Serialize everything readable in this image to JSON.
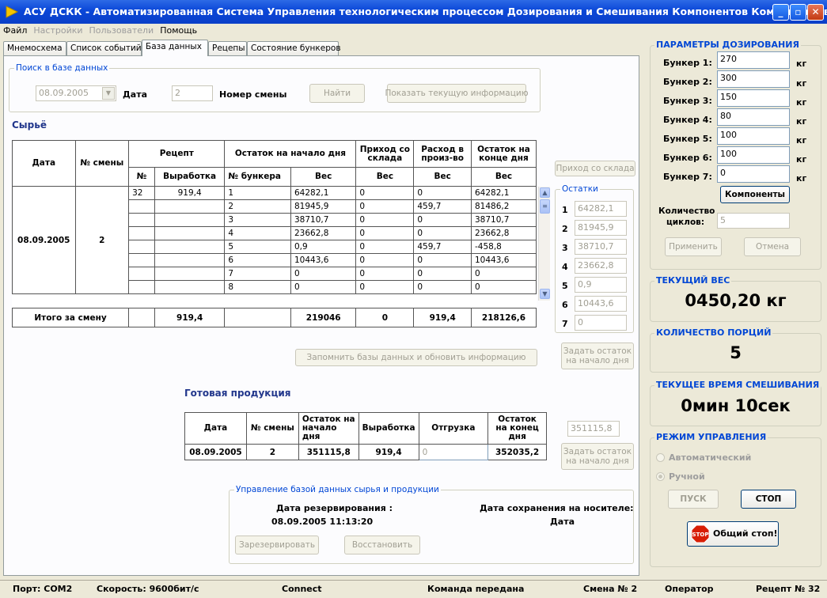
{
  "window": {
    "title": "АСУ ДСКК - Автоматизированная Система Управления технологическим процессом Дозирования и Смешивания Компонентов Комбикормов"
  },
  "menu": {
    "file": "Файл",
    "settings": "Настройки",
    "users": "Пользователи",
    "help": "Помощь"
  },
  "tabs": [
    "Мнемосхема",
    "Список событий",
    "База данных",
    "Рецепы",
    "Состояние бункеров"
  ],
  "search": {
    "title": "Поиск в базе данных",
    "date_value": "08.09.2005",
    "date_label": "Дата",
    "shift_value": "2",
    "shift_label": "Номер смены",
    "find_btn": "Найти",
    "show_btn": "Показать текущую информацию"
  },
  "raw": {
    "title": "Сырьё",
    "h_date": "Дата",
    "h_shift": "№ смены",
    "h_recipe": "Рецепт",
    "h_rec_no": "№",
    "h_rec_out": "Выработка",
    "h_start": "Остаток на начало дня",
    "h_bunker": "№ бункера",
    "h_weight": "Вес",
    "h_in": "Приход со склада",
    "h_use": "Расход в произ-во",
    "h_end": "Остаток на конце дня",
    "date": "08.09.2005",
    "shift": "2",
    "rec_no": "32",
    "rec_out": "919,4",
    "rows": [
      {
        "b": "1",
        "w": "64282,1",
        "in": "0",
        "use": "0",
        "end": "64282,1"
      },
      {
        "b": "2",
        "w": "81945,9",
        "in": "0",
        "use": "459,7",
        "end": "81486,2"
      },
      {
        "b": "3",
        "w": "38710,7",
        "in": "0",
        "use": "0",
        "end": "38710,7"
      },
      {
        "b": "4",
        "w": "23662,8",
        "in": "0",
        "use": "0",
        "end": "23662,8"
      },
      {
        "b": "5",
        "w": "0,9",
        "in": "0",
        "use": "459,7",
        "end": "-458,8"
      },
      {
        "b": "6",
        "w": "10443,6",
        "in": "0",
        "use": "0",
        "end": "10443,6"
      },
      {
        "b": "7",
        "w": "0",
        "in": "0",
        "use": "0",
        "end": "0"
      },
      {
        "b": "8",
        "w": "0",
        "in": "0",
        "use": "0",
        "end": "0"
      }
    ],
    "total_label": "Итого за смену",
    "total_out": "919,4",
    "total_w": "219046",
    "total_in": "0",
    "total_use": "919,4",
    "total_end": "218126,6",
    "income_btn": "Приход со склада",
    "remains_label": "Остатки",
    "remains": [
      {
        "n": "1",
        "v": "64282,1"
      },
      {
        "n": "2",
        "v": "81945,9"
      },
      {
        "n": "3",
        "v": "38710,7"
      },
      {
        "n": "4",
        "v": "23662,8"
      },
      {
        "n": "5",
        "v": "0,9"
      },
      {
        "n": "6",
        "v": "10443,6"
      },
      {
        "n": "7",
        "v": "0"
      }
    ],
    "save_btn": "Запомнить базы данных и обновить информацию",
    "set_btn": "Задать остаток на начало дня"
  },
  "product": {
    "title": "Готовая продукция",
    "h_date": "Дата",
    "h_shift": "№ смены",
    "h_start": "Остаток на начало дня",
    "h_out": "Выработка",
    "h_ship": "Отгрузка",
    "h_end": "Остаток на конец дня",
    "date": "08.09.2005",
    "shift": "2",
    "start": "351115,8",
    "out": "919,4",
    "ship": "0",
    "end": "352035,2",
    "remain": "351115,8",
    "set_btn": "Задать остаток на начало дня"
  },
  "db": {
    "title": "Управление базой данных сырья и продукции",
    "res_label": "Дата резервирования :",
    "res_value": "08.09.2005 11:13:20",
    "save_label": "Дата сохранения на носителе:",
    "save_value": "Дата",
    "reserve_btn": "Зарезервировать",
    "restore_btn": "Восстановить"
  },
  "params": {
    "title": "ПАРАМЕТРЫ ДОЗИРОВАНИЯ",
    "unit": "кг",
    "bunkers": [
      {
        "label": "Бункер 1:",
        "v": "270"
      },
      {
        "label": "Бункер 2:",
        "v": "300"
      },
      {
        "label": "Бункер 3:",
        "v": "150"
      },
      {
        "label": "Бункер 4:",
        "v": "80"
      },
      {
        "label": "Бункер 5:",
        "v": "100"
      },
      {
        "label": "Бункер 6:",
        "v": "100"
      },
      {
        "label": "Бункер 7:",
        "v": "0"
      }
    ],
    "components_btn": "Компоненты",
    "cycles_label1": "Количество",
    "cycles_label2": "циклов:",
    "cycles_value": "5",
    "apply_btn": "Применить",
    "cancel_btn": "Отмена"
  },
  "weight": {
    "title": "ТЕКУЩИЙ ВЕС",
    "value": "0450,20 кг"
  },
  "portions": {
    "title": "КОЛИЧЕСТВО ПОРЦИЙ",
    "value": "5"
  },
  "mixtime": {
    "title": "ТЕКУЩЕЕ ВРЕМЯ СМЕШИВАНИЯ",
    "value": "0мин 10сек"
  },
  "mode": {
    "title": "РЕЖИМ УПРАВЛЕНИЯ",
    "auto": "Автоматический",
    "manual": "Ручной",
    "start_btn": "ПУСК",
    "stop_btn": "СТОП",
    "estop_btn": "Общий стоп!",
    "estop_icon_text": "STOP"
  },
  "status": {
    "port": "Порт: COM2",
    "speed": "Скорость: 9600бит/с",
    "connect": "Connect",
    "cmd": "Команда передана",
    "shift": "Смена № 2",
    "role": "Оператор",
    "recipe": "Рецепт № 32"
  }
}
